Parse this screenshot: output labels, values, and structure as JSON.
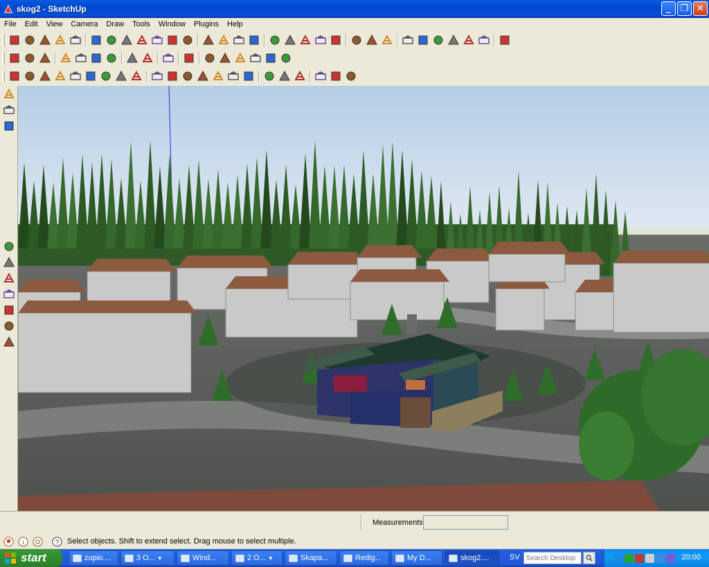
{
  "window": {
    "title": "skog2 - SketchUp"
  },
  "menu": [
    "File",
    "Edit",
    "View",
    "Camera",
    "Draw",
    "Tools",
    "Window",
    "Plugins",
    "Help"
  ],
  "toolbars": {
    "row1": [
      "select-tool",
      "pencil-tool",
      "rectangle-tool",
      "circle-tool",
      "arc-tool",
      "make-component",
      "eraser-tool",
      "paint-bucket",
      "push-pull",
      "move-tool",
      "rotate-tool",
      "follow-me",
      "orbit-tool",
      "pan-tool",
      "zoom-tool",
      "zoom-extents",
      "get-location",
      "toggle-terrain",
      "add-location",
      "photo-textures",
      "get-models",
      "share-model",
      "section-plane",
      "display-section-planes",
      "x-ray",
      "back-edges",
      "wireframe",
      "hidden-line",
      "shaded",
      "textured",
      "sandbox"
    ],
    "row2": [
      "new-file",
      "open-file",
      "save-file",
      "cut",
      "copy",
      "paste",
      "delete",
      "undo",
      "redo",
      "print",
      "model-info",
      "iso-view",
      "top-view",
      "front-view",
      "right-view",
      "back-view",
      "left-view"
    ],
    "row3": [
      "google-earth",
      "get-current-view",
      "kmz-export",
      "place-model",
      "get-models-2",
      "pop",
      "camera-snapshot",
      "z-question",
      "model-tools",
      "section-1",
      "section-2",
      "section-3",
      "section-4",
      "section-5",
      "face-tool",
      "section-6",
      "diamond-tool",
      "plane-2",
      "plane-3",
      "export-kmz-2",
      "export-kmz-3",
      "export-kmz-4"
    ]
  },
  "left_tools": [
    "position-camera",
    "walk",
    "look-around",
    "orbit",
    "pan",
    "zoom",
    "zoom-window",
    "zoom-extents-2",
    "previous-view",
    "next-view"
  ],
  "measurements": {
    "label": "Measurements",
    "value": ""
  },
  "status": {
    "text": "Select objects. Shift to extend select. Drag mouse to select multiple."
  },
  "taskbar": {
    "start_label": "start",
    "items": [
      {
        "label": "zupio....",
        "icon": "globe-icon",
        "arrow": false,
        "active": false
      },
      {
        "label": "3 O...",
        "icon": "explorer-icon",
        "arrow": true,
        "active": false
      },
      {
        "label": "Wind...",
        "icon": "window-icon",
        "arrow": false,
        "active": false
      },
      {
        "label": "2 O...",
        "icon": "word-icon",
        "arrow": true,
        "active": false
      },
      {
        "label": "Skapa...",
        "icon": "ie-icon",
        "arrow": false,
        "active": false
      },
      {
        "label": "Redig...",
        "icon": "edit-icon",
        "arrow": false,
        "active": false
      },
      {
        "label": "My D...",
        "icon": "folder-icon",
        "arrow": false,
        "active": false
      },
      {
        "label": "skog2....",
        "icon": "sketchup-icon",
        "arrow": false,
        "active": true
      }
    ],
    "language": "SV",
    "search_placeholder": "Search Desktop",
    "clock": "20:00"
  },
  "colors": {
    "titlebar": "#0047d0",
    "sky_top": "#bcd3e8",
    "sky_bottom": "#e7eef4",
    "ground": "#5a5d5a",
    "roof": "#8b5a40",
    "wall": "#c8c8c8",
    "house_blue": "#2c3468",
    "tree": "#2f6b2a",
    "taskbar": "#245edb",
    "start": "#2f8d2f"
  }
}
